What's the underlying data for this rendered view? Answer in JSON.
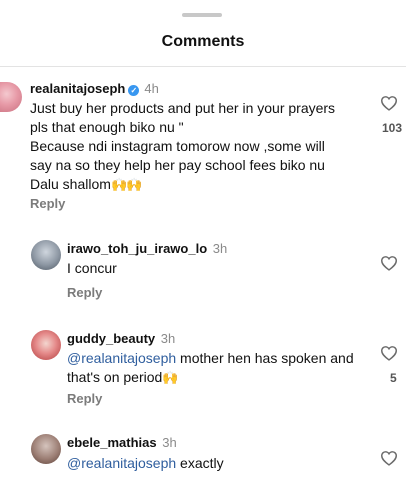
{
  "header": {
    "title": "Comments"
  },
  "comments": [
    {
      "username": "realanitajoseph",
      "verified": true,
      "time": "4h",
      "line1": "Just buy her products and put her in your prayers pls that enough biko nu \"",
      "line2": "Because ndi instagram tomorow now ,some will say na so they help her pay school fees biko nu Dalu shallom",
      "emoji": "🙌🙌",
      "reply_label": "Reply",
      "likes": "103"
    },
    {
      "username": "irawo_toh_ju_irawo_lo",
      "time": "3h",
      "text": "I concur",
      "reply_label": "Reply"
    },
    {
      "username": "guddy_beauty",
      "time": "3h",
      "mention": "@realanitajoseph",
      "text": " mother hen has spoken and that's on period",
      "emoji": "🙌",
      "reply_label": "Reply",
      "likes": "5"
    },
    {
      "username": "ebele_mathias",
      "time": "3h",
      "mention": "@realanitajoseph",
      "text": " exactly"
    }
  ],
  "colors": {
    "mention": "#2f5e9e",
    "verified": "#3897f0",
    "muted": "#8a8a8a"
  }
}
